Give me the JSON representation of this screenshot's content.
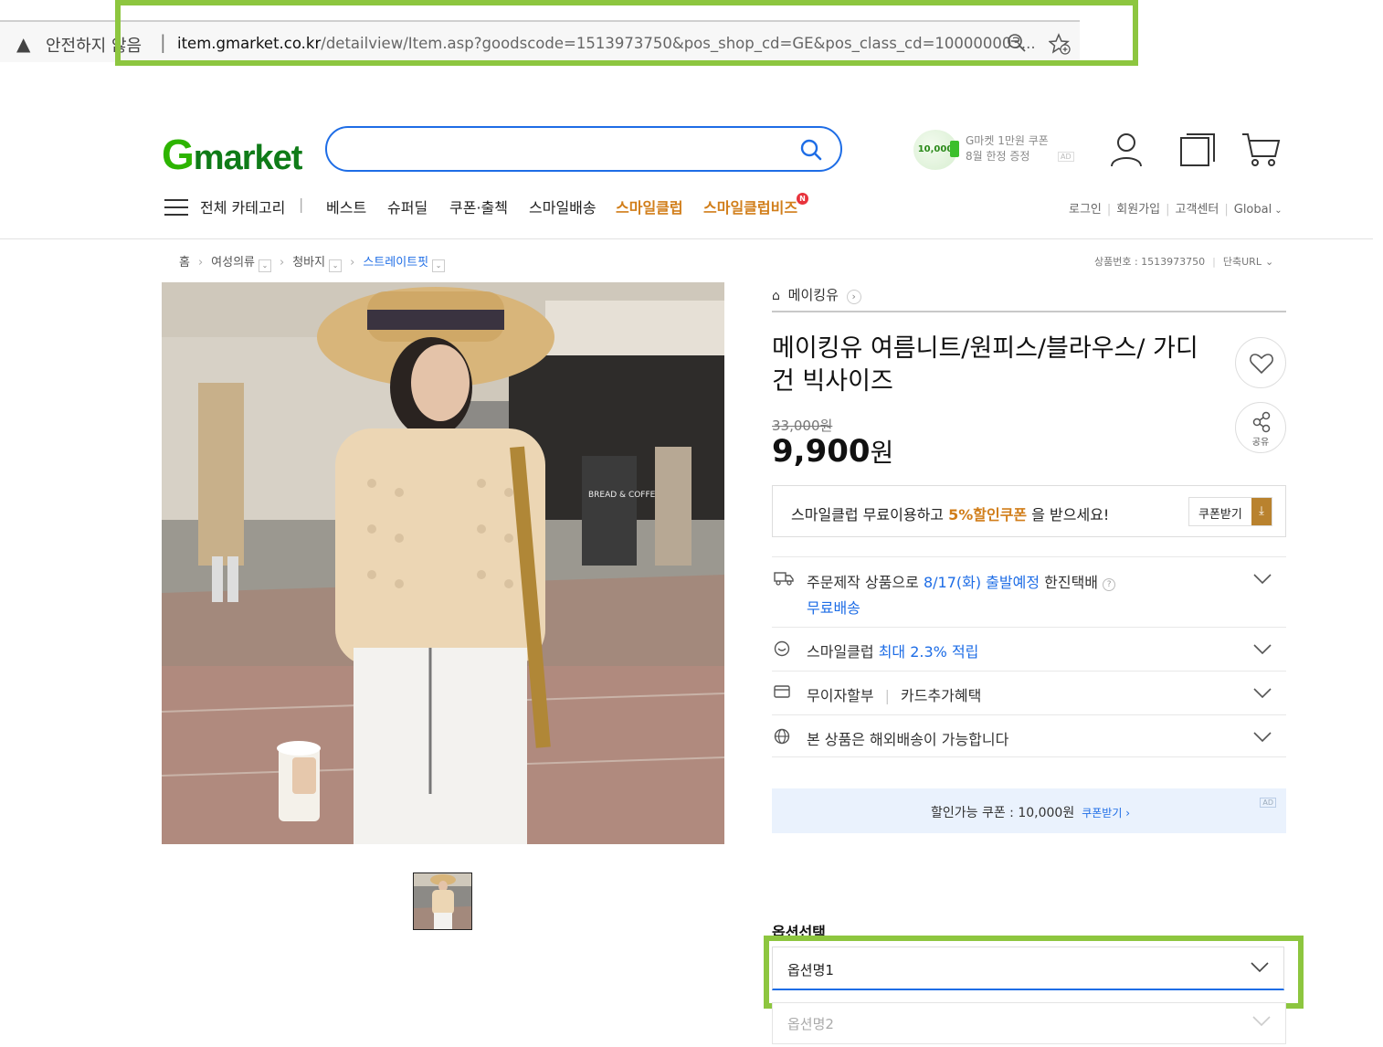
{
  "browser": {
    "security_text": "안전하지 않음",
    "url_host": "item.gmarket.co.kr",
    "url_rest": "/detailview/Item.asp?goodscode=1513973750&pos_shop_cd=GE&pos_class_cd=100000003..."
  },
  "header": {
    "logo_g": "G",
    "logo_rest": "market",
    "search_placeholder": "",
    "promo_coin": "10,000",
    "promo_line1": "G마켓 1만원 쿠폰",
    "promo_line2": "8월 한정 증정",
    "promo_ad": "AD"
  },
  "nav": {
    "all_category": "전체 카테고리",
    "items": [
      "베스트",
      "슈퍼딜",
      "쿠폰·출첵",
      "스마일배송"
    ],
    "smileclub": "스마일클럽",
    "smileclub_biz": "스마일클럽비즈",
    "new_badge": "N",
    "util": [
      "로그인",
      "회원가입",
      "고객센터",
      "Global"
    ]
  },
  "breadcrumb": {
    "home": "홈",
    "cat1": "여성의류",
    "cat2": "청바지",
    "cat3": "스트레이트핏",
    "goods_no": "상품번호 : 1513973750",
    "short_url": "단축URL"
  },
  "product": {
    "seller": "메이킹유",
    "title": "메이킹유 여름니트/원피스/블라우스/ 가디건 빅사이즈",
    "old_price": "33,000원",
    "price_num": "9,900",
    "price_unit": "원",
    "share_label": "공유",
    "image_sign": "BREAD & COFFEE"
  },
  "smileclub_box": {
    "msg_before": "스마일클럽 무료이용하고 ",
    "msg_bold": "5%할인쿠폰",
    "msg_after": " 을 받으세요!",
    "button": "쿠폰받기"
  },
  "info": {
    "delivery_prefix": "주문제작 상품으로 ",
    "delivery_date": "8/17(화) 출발예정",
    "delivery_courier": " 한진택배",
    "delivery_free": "무료배송",
    "smile_prefix": "스마일클럽 ",
    "smile_rate": "최대 2.3% 적립",
    "installment": "무이자할부",
    "card": "카드추가혜택",
    "overseas": "본 상품은 해외배송이 가능합니다"
  },
  "coupon_banner": {
    "text": "할인가능 쿠폰 : 10,000원",
    "link": "쿠폰받기 ›",
    "ad": "AD"
  },
  "options": {
    "label": "옵션선택",
    "opt1": "옵션명1",
    "opt2": "옵션명2"
  }
}
